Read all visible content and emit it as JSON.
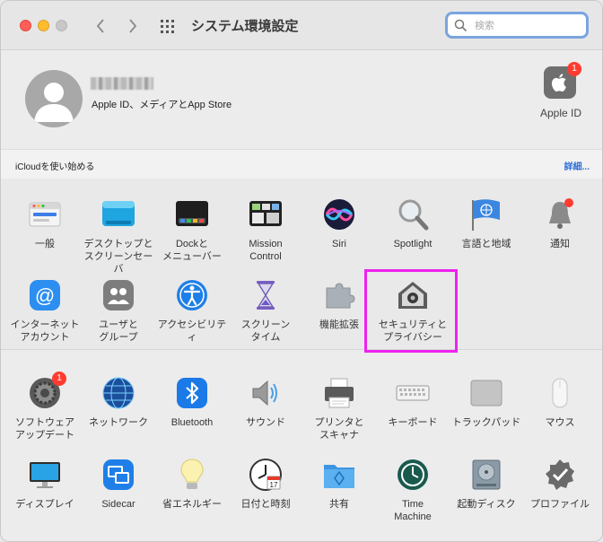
{
  "window": {
    "title": "システム環境設定"
  },
  "search": {
    "placeholder": "検索"
  },
  "account": {
    "subtitle": "Apple ID、メディアとApp Store",
    "apple_id_label": "Apple ID",
    "apple_id_badge": "1"
  },
  "icloud": {
    "prompt": "iCloudを使い始める",
    "details_link": "詳細..."
  },
  "section1": [
    {
      "label": "一般",
      "icon": "general-icon"
    },
    {
      "label": "デスクトップと\nスクリーンセーバ",
      "icon": "desktop-icon"
    },
    {
      "label": "Dockと\nメニューバー",
      "icon": "dock-icon"
    },
    {
      "label": "Mission\nControl",
      "icon": "mission-control-icon"
    },
    {
      "label": "Siri",
      "icon": "siri-icon"
    },
    {
      "label": "Spotlight",
      "icon": "spotlight-icon"
    },
    {
      "label": "言語と地域",
      "icon": "language-region-icon"
    },
    {
      "label": "通知",
      "icon": "notifications-icon"
    },
    {
      "label": "インターネット\nアカウント",
      "icon": "internet-accounts-icon"
    },
    {
      "label": "ユーザと\nグループ",
      "icon": "users-groups-icon"
    },
    {
      "label": "アクセシビリティ",
      "icon": "accessibility-icon"
    },
    {
      "label": "スクリーン\nタイム",
      "icon": "screen-time-icon"
    },
    {
      "label": "機能拡張",
      "icon": "extensions-icon"
    },
    {
      "label": "セキュリティと\nプライバシー",
      "icon": "security-privacy-icon"
    }
  ],
  "section2": [
    {
      "label": "ソフトウェア\nアップデート",
      "icon": "software-update-icon",
      "badge": "1"
    },
    {
      "label": "ネットワーク",
      "icon": "network-icon"
    },
    {
      "label": "Bluetooth",
      "icon": "bluetooth-icon"
    },
    {
      "label": "サウンド",
      "icon": "sound-icon"
    },
    {
      "label": "プリンタと\nスキャナ",
      "icon": "printers-icon"
    },
    {
      "label": "キーボード",
      "icon": "keyboard-icon"
    },
    {
      "label": "トラックパッド",
      "icon": "trackpad-icon"
    },
    {
      "label": "マウス",
      "icon": "mouse-icon"
    },
    {
      "label": "ディスプレイ",
      "icon": "displays-icon"
    },
    {
      "label": "Sidecar",
      "icon": "sidecar-icon"
    },
    {
      "label": "省エネルギー",
      "icon": "energy-saver-icon"
    },
    {
      "label": "日付と時刻",
      "icon": "date-time-icon"
    },
    {
      "label": "共有",
      "icon": "sharing-icon"
    },
    {
      "label": "Time\nMachine",
      "icon": "time-machine-icon"
    },
    {
      "label": "起動ディスク",
      "icon": "startup-disk-icon"
    },
    {
      "label": "プロファイル",
      "icon": "profiles-icon"
    }
  ],
  "colors": {
    "highlight": "#ee22ee",
    "link": "#2f6fd6",
    "badge": "#ff3b30"
  },
  "notifications_badge": true
}
